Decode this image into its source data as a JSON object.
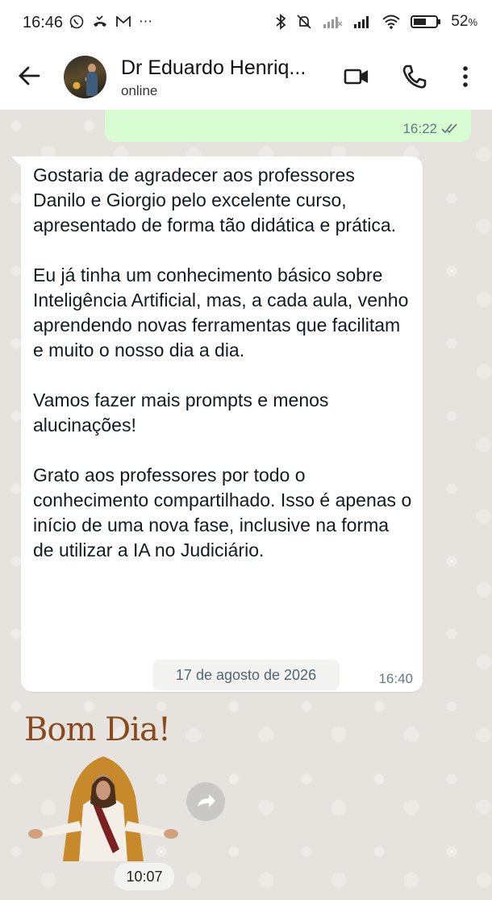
{
  "status_bar": {
    "time": "16:46",
    "left_icons": [
      "whatsapp-icon",
      "missed-call-icon",
      "gmail-icon",
      "more-dots-icon"
    ],
    "right_icons": [
      "bluetooth-icon",
      "mute-icon",
      "signal-icon",
      "signal-icon",
      "wifi-icon",
      "battery-icon"
    ],
    "battery": "52",
    "battery_unit": "%"
  },
  "header": {
    "contact_name": "Dr Eduardo Henriq...",
    "status": "online"
  },
  "messages": {
    "outgoing": {
      "time": "16:22",
      "ticks": "read"
    },
    "incoming": {
      "paragraphs": [
        "Gostaria de agradecer aos professores Danilo e Giorgio pelo excelente curso, apresentado de forma tão didática e prática.",
        "Eu já tinha um conhecimento básico sobre Inteligência Artificial, mas, a cada aula, venho aprendendo novas ferramentas que facilitam e muito o nosso dia a dia.",
        "Vamos fazer mais prompts e menos alucinações!",
        "Grato aos professores por todo o conhecimento compartilhado. Isso é apenas o início de uma nova fase, inclusive na forma de utilizar a IA no Judiciário."
      ],
      "time": "16:40"
    },
    "date_separator": "17 de agosto de 2026",
    "sticker": {
      "title": "Bom Dia!",
      "time": "10:07"
    }
  },
  "colors": {
    "outgoing_bubble": "#d9fdd3",
    "incoming_bubble": "#ffffff",
    "chat_background": "#e6e2dd",
    "read_ticks": "#667781"
  }
}
